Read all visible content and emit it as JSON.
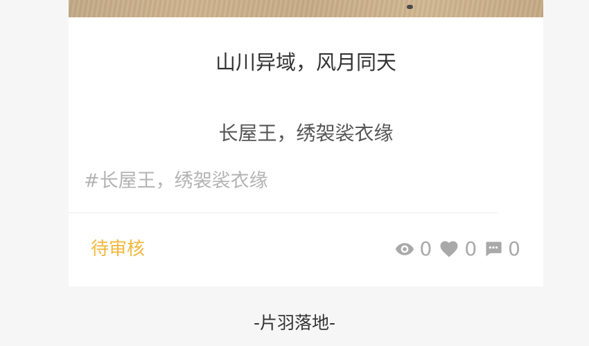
{
  "post": {
    "title": "山川异域，风月同天",
    "subtitle": "长屋王，绣袈裟衣缘",
    "tag": "#长屋王，绣袈裟衣缘",
    "status": "待审核",
    "stats": {
      "views": "0",
      "likes": "0",
      "comments": "0"
    }
  },
  "footer": {
    "text": "-片羽落地-"
  },
  "colors": {
    "status": "#f0b83c",
    "muted": "#a9a9a9",
    "background": "#f6f6f6"
  },
  "icons": {
    "views": "eye-icon",
    "likes": "heart-icon",
    "comments": "comment-icon"
  }
}
